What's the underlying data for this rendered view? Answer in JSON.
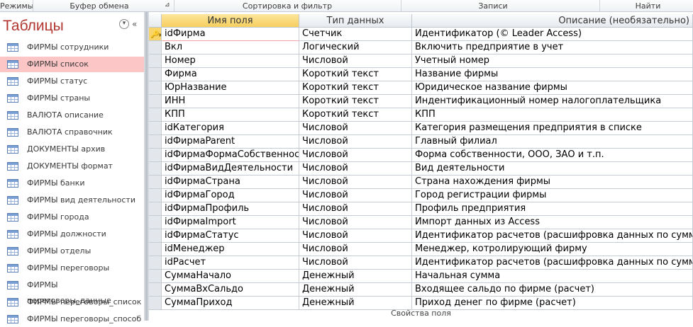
{
  "ribbon": {
    "groups": [
      "Режимы",
      "Буфер обмена",
      "Сортировка и фильтр",
      "Записи",
      "Найти"
    ]
  },
  "sidebar": {
    "title": "Таблицы",
    "items": [
      "ФИРМЫ сотрудники",
      "ФИРМЫ список",
      "ФИРМЫ статус",
      "ФИРМЫ страны",
      "ВАЛЮТА описание",
      "ВАЛЮТА справочник",
      "ДОКУМЕНТЫ архив",
      "ДОКУМЕНТЫ формат",
      "ФИРМЫ банки",
      "ФИРМЫ вид деятельности",
      "ФИРМЫ города",
      "ФИРМЫ должности",
      "ФИРМЫ отделы",
      "ФИРМЫ переговоры",
      "ФИРМЫ переговоры_данные",
      "ФИРМЫ переговоры_список",
      "ФИРМЫ переговоры_способ"
    ],
    "selected": 1
  },
  "grid": {
    "headers": [
      "Имя поля",
      "Тип данных",
      "Описание (необязательно)"
    ],
    "rows": [
      [
        "idФирма",
        "Счетчик",
        "Идентификатор (©  Leader Access)"
      ],
      [
        "Вкл",
        "Логический",
        "Включить предприятие в учет"
      ],
      [
        "Номер",
        "Числовой",
        "Учетный номер"
      ],
      [
        "Фирма",
        "Короткий текст",
        "Название фирмы"
      ],
      [
        "ЮрНазвание",
        "Короткий текст",
        "Юридическое название фирмы"
      ],
      [
        "ИНН",
        "Короткий текст",
        "Индентификационный номер налогоплательщика"
      ],
      [
        "КПП",
        "Короткий текст",
        "КПП"
      ],
      [
        "idКатегория",
        "Числовой",
        "Категория размещения предприятия в списке"
      ],
      [
        "idФирмаParent",
        "Числовой",
        "Главный филиал"
      ],
      [
        "idФирмаФормаСобственности",
        "Числовой",
        "Форма собственности, ООО, ЗАО и т.п."
      ],
      [
        "idФирмаВидДеятельности",
        "Числовой",
        "Вид деятельности"
      ],
      [
        "idФирмаСтрана",
        "Числовой",
        "Страна нахождения фирмы"
      ],
      [
        "idФирмаГород",
        "Числовой",
        "Город регистрации фирмы"
      ],
      [
        "idФирмаПрофиль",
        "Числовой",
        "Профиль предприятия"
      ],
      [
        "idФирмаImport",
        "Числовой",
        "Импорт данных из Access"
      ],
      [
        "idФирмаСтатус",
        "Числовой",
        "Идентификатор расчетов (расшифровка данных по сумме)"
      ],
      [
        "idМенеджер",
        "Числовой",
        "Менеджер, котролирующий фирму"
      ],
      [
        "idРасчет",
        "Числовой",
        "Идентификатор расчетов (расшифровка данных по сумме)"
      ],
      [
        "СуммаНачало",
        "Денежный",
        "Начальная сумма"
      ],
      [
        "СуммаВхСальдо",
        "Денежный",
        "Входящее сальдо по фирме (расчет)"
      ],
      [
        "СуммаПриход",
        "Денежный",
        "Приход денег по фирме (расчет)"
      ]
    ]
  },
  "footer": "Свойства поля"
}
